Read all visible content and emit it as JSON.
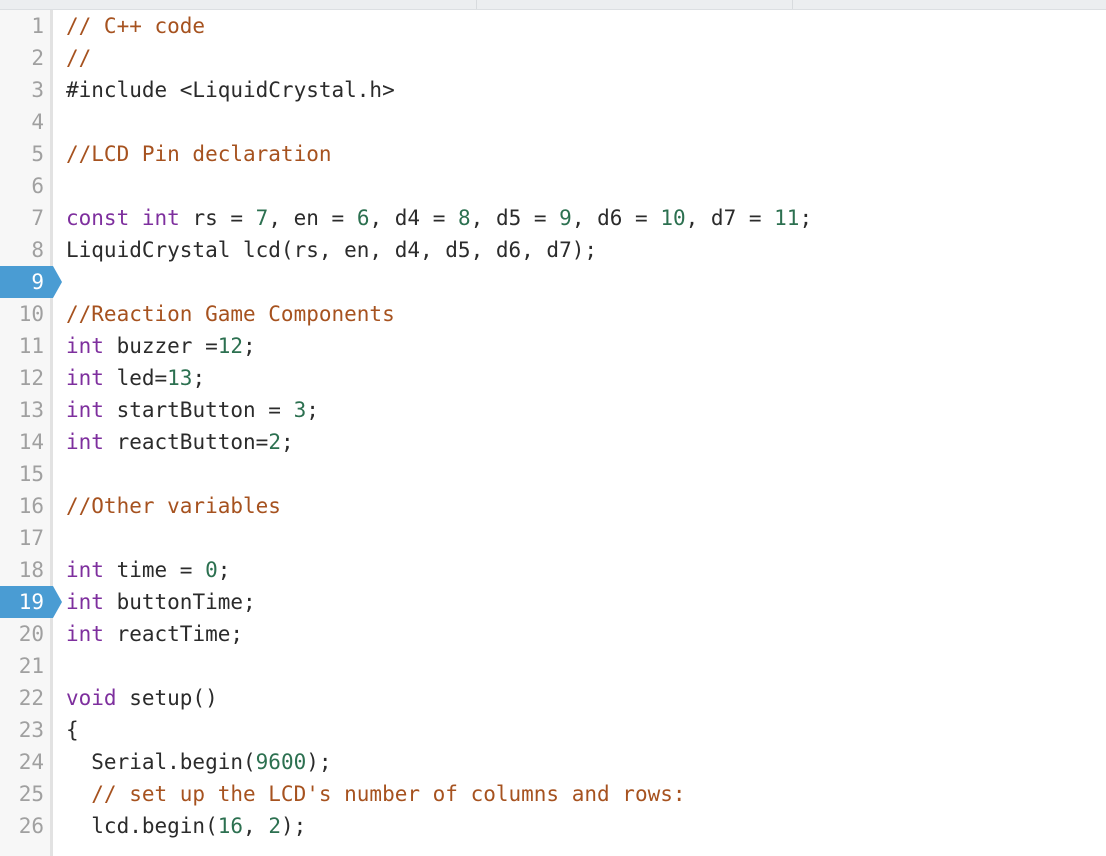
{
  "window": {
    "top_bar": {
      "cells": [
        "",
        "",
        ""
      ]
    }
  },
  "editor": {
    "language": "C++",
    "colors": {
      "comment": "#a6521f",
      "keyword": "#7e2f9e",
      "number": "#2c7050",
      "plain": "#2b2b2b",
      "line_number": "#a0a0a0",
      "marker_blue": "#4a9cd3",
      "gutter_bg": "#f7f7f7",
      "background": "#ffffff"
    },
    "marked_lines": [
      9,
      19
    ],
    "lines": [
      {
        "n": "1",
        "marked": false,
        "tokens": [
          {
            "t": "// C++ code",
            "c": "comment"
          }
        ]
      },
      {
        "n": "2",
        "marked": false,
        "tokens": [
          {
            "t": "//",
            "c": "comment"
          }
        ]
      },
      {
        "n": "3",
        "marked": false,
        "tokens": [
          {
            "t": "#include <LiquidCrystal.h>",
            "c": "plain"
          }
        ]
      },
      {
        "n": "4",
        "marked": false,
        "tokens": []
      },
      {
        "n": "5",
        "marked": false,
        "tokens": [
          {
            "t": "//LCD Pin declaration",
            "c": "comment"
          }
        ]
      },
      {
        "n": "6",
        "marked": false,
        "tokens": []
      },
      {
        "n": "7",
        "marked": false,
        "tokens": [
          {
            "t": "const int",
            "c": "keyword"
          },
          {
            "t": " rs = ",
            "c": "plain"
          },
          {
            "t": "7",
            "c": "number"
          },
          {
            "t": ", en = ",
            "c": "plain"
          },
          {
            "t": "6",
            "c": "number"
          },
          {
            "t": ", d4 = ",
            "c": "plain"
          },
          {
            "t": "8",
            "c": "number"
          },
          {
            "t": ", d5 = ",
            "c": "plain"
          },
          {
            "t": "9",
            "c": "number"
          },
          {
            "t": ", d6 = ",
            "c": "plain"
          },
          {
            "t": "10",
            "c": "number"
          },
          {
            "t": ", d7 = ",
            "c": "plain"
          },
          {
            "t": "11",
            "c": "number"
          },
          {
            "t": ";",
            "c": "plain"
          }
        ]
      },
      {
        "n": "8",
        "marked": false,
        "tokens": [
          {
            "t": "LiquidCrystal lcd(rs, en, d4, d5, d6, d7);",
            "c": "plain"
          }
        ]
      },
      {
        "n": "9",
        "marked": true,
        "tokens": []
      },
      {
        "n": "10",
        "marked": false,
        "tokens": [
          {
            "t": "//Reaction Game Components",
            "c": "comment"
          }
        ]
      },
      {
        "n": "11",
        "marked": false,
        "tokens": [
          {
            "t": "int",
            "c": "keyword"
          },
          {
            "t": " buzzer =",
            "c": "plain"
          },
          {
            "t": "12",
            "c": "number"
          },
          {
            "t": ";",
            "c": "plain"
          }
        ]
      },
      {
        "n": "12",
        "marked": false,
        "tokens": [
          {
            "t": "int",
            "c": "keyword"
          },
          {
            "t": " led=",
            "c": "plain"
          },
          {
            "t": "13",
            "c": "number"
          },
          {
            "t": ";",
            "c": "plain"
          }
        ]
      },
      {
        "n": "13",
        "marked": false,
        "tokens": [
          {
            "t": "int",
            "c": "keyword"
          },
          {
            "t": " startButton = ",
            "c": "plain"
          },
          {
            "t": "3",
            "c": "number"
          },
          {
            "t": ";",
            "c": "plain"
          }
        ]
      },
      {
        "n": "14",
        "marked": false,
        "tokens": [
          {
            "t": "int",
            "c": "keyword"
          },
          {
            "t": " reactButton=",
            "c": "plain"
          },
          {
            "t": "2",
            "c": "number"
          },
          {
            "t": ";",
            "c": "plain"
          }
        ]
      },
      {
        "n": "15",
        "marked": false,
        "tokens": []
      },
      {
        "n": "16",
        "marked": false,
        "tokens": [
          {
            "t": "//Other variables",
            "c": "comment"
          }
        ]
      },
      {
        "n": "17",
        "marked": false,
        "tokens": []
      },
      {
        "n": "18",
        "marked": false,
        "tokens": [
          {
            "t": "int",
            "c": "keyword"
          },
          {
            "t": " time = ",
            "c": "plain"
          },
          {
            "t": "0",
            "c": "number"
          },
          {
            "t": ";",
            "c": "plain"
          }
        ]
      },
      {
        "n": "19",
        "marked": true,
        "tokens": [
          {
            "t": "int",
            "c": "keyword"
          },
          {
            "t": " buttonTime;",
            "c": "plain"
          }
        ]
      },
      {
        "n": "20",
        "marked": false,
        "tokens": [
          {
            "t": "int",
            "c": "keyword"
          },
          {
            "t": " reactTime;",
            "c": "plain"
          }
        ]
      },
      {
        "n": "21",
        "marked": false,
        "tokens": []
      },
      {
        "n": "22",
        "marked": false,
        "tokens": [
          {
            "t": "void",
            "c": "keyword"
          },
          {
            "t": " setup()",
            "c": "plain"
          }
        ]
      },
      {
        "n": "23",
        "marked": false,
        "tokens": [
          {
            "t": "{",
            "c": "plain"
          }
        ]
      },
      {
        "n": "24",
        "marked": false,
        "tokens": [
          {
            "t": "  Serial.begin(",
            "c": "plain"
          },
          {
            "t": "9600",
            "c": "number"
          },
          {
            "t": ");",
            "c": "plain"
          }
        ]
      },
      {
        "n": "25",
        "marked": false,
        "tokens": [
          {
            "t": "  // set up the LCD's number of columns and rows:",
            "c": "comment"
          }
        ]
      },
      {
        "n": "26",
        "marked": false,
        "tokens": [
          {
            "t": "  lcd.begin(",
            "c": "plain"
          },
          {
            "t": "16",
            "c": "number"
          },
          {
            "t": ", ",
            "c": "plain"
          },
          {
            "t": "2",
            "c": "number"
          },
          {
            "t": ");",
            "c": "plain"
          }
        ]
      }
    ]
  }
}
